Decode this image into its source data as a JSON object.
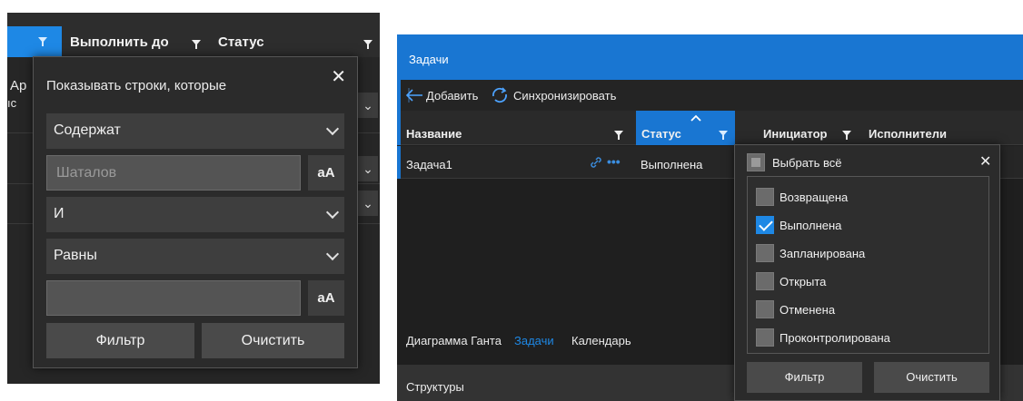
{
  "left_panel": {
    "header": {
      "col_due": "Выполнить до",
      "col_status": "Статус"
    },
    "background": {
      "text_1": "Ар",
      "text_2": "ıс"
    },
    "filter_popup": {
      "title": "Показывать строки, которые",
      "operator_1": "Содержат",
      "value_1": "Шаталов",
      "case_label_1": "aA",
      "logic": "И",
      "operator_2": "Равны",
      "value_2": "",
      "case_label_2": "aA",
      "filter_label": "Фильтр",
      "clear_label": "Очистить",
      "close_glyph": "✕"
    }
  },
  "right_panel": {
    "title": "Задачи",
    "toolbar": {
      "add_label": "Добавить",
      "sync_label": "Синхронизировать"
    },
    "columns": {
      "name": "Название",
      "status": "Статус",
      "initiator": "Инициатор",
      "performers": "Исполнители"
    },
    "rows": [
      {
        "name": "Задача1",
        "status": "Выполнена"
      }
    ],
    "tabs": {
      "gantt": "Диаграмма Ганта",
      "tasks": "Задачи",
      "calendar": "Календарь"
    },
    "structures": "Структуры",
    "status_filter": {
      "select_all": "Выбрать всё",
      "options": [
        {
          "label": "Возвращена",
          "checked": false
        },
        {
          "label": "Выполнена",
          "checked": true
        },
        {
          "label": "Запланирована",
          "checked": false
        },
        {
          "label": "Открыта",
          "checked": false
        },
        {
          "label": "Отменена",
          "checked": false
        },
        {
          "label": "Проконтролирована",
          "checked": false
        }
      ],
      "filter_label": "Фильтр",
      "clear_label": "Очистить",
      "close_glyph": "✕"
    }
  },
  "colors": {
    "accent": "#1976d2",
    "panel_bg": "#262626",
    "popup_bg": "#2b2b2b",
    "control_bg": "#3e3e3e"
  },
  "icons": [
    "filter-icon",
    "close-icon",
    "chevron-down-icon",
    "back-arrow-icon",
    "sync-icon",
    "link-icon",
    "more-icon",
    "sort-up-icon",
    "checkbox-icon"
  ]
}
